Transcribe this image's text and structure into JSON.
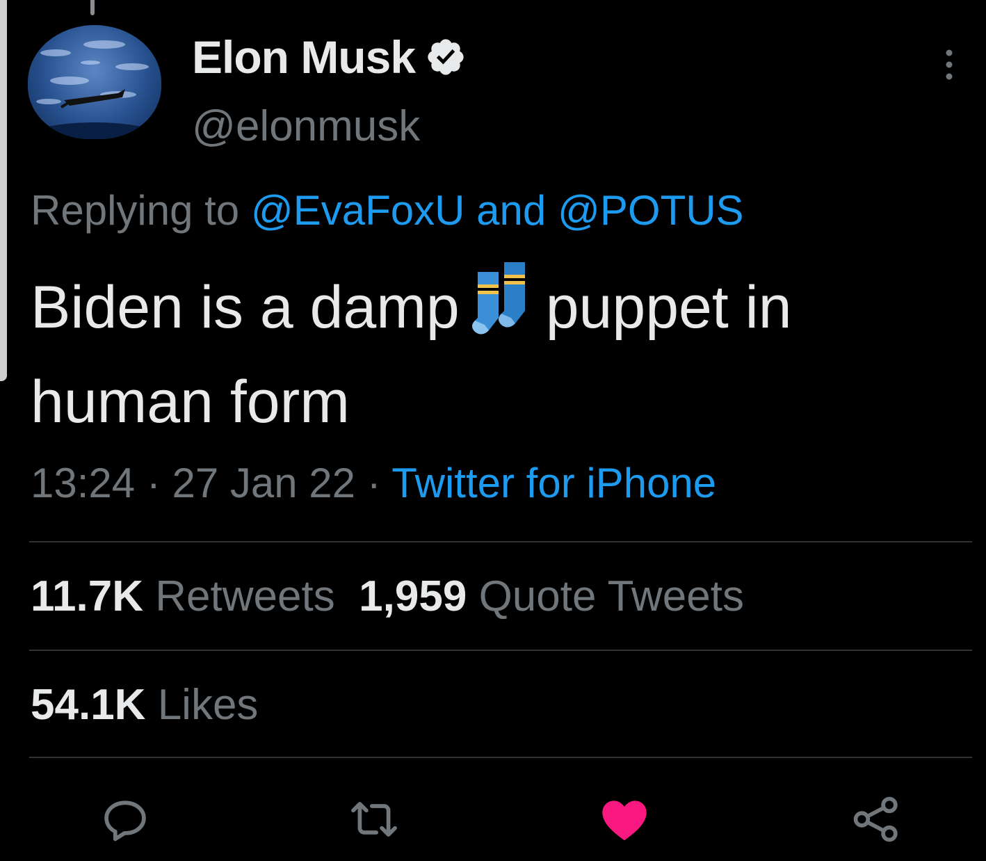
{
  "author": {
    "name": "Elon Musk",
    "handle": "@elonmusk",
    "verified": true
  },
  "reply": {
    "prefix": "Replying to ",
    "user1": "@EvaFoxU",
    "connector": " and ",
    "user2": "@POTUS"
  },
  "tweet": {
    "text_before": "Biden is a damp",
    "emoji": "socks-emoji",
    "text_after": "puppet in human form"
  },
  "meta": {
    "time": "13:24",
    "sep1": " · ",
    "date": "27 Jan 22",
    "sep2": " · ",
    "source": "Twitter for iPhone"
  },
  "stats": {
    "retweets_count": "11.7K",
    "retweets_label": "Retweets",
    "quotes_count": "1,959",
    "quotes_label": "Quote Tweets",
    "likes_count": "54.1K",
    "likes_label": "Likes"
  },
  "actions": [
    "reply-icon",
    "retweet-icon",
    "like-icon",
    "share-icon"
  ],
  "colors": {
    "background": "#000000",
    "text": "#e7e9ea",
    "muted": "#71767b",
    "link": "#1d9bf0",
    "like": "#f91880"
  }
}
